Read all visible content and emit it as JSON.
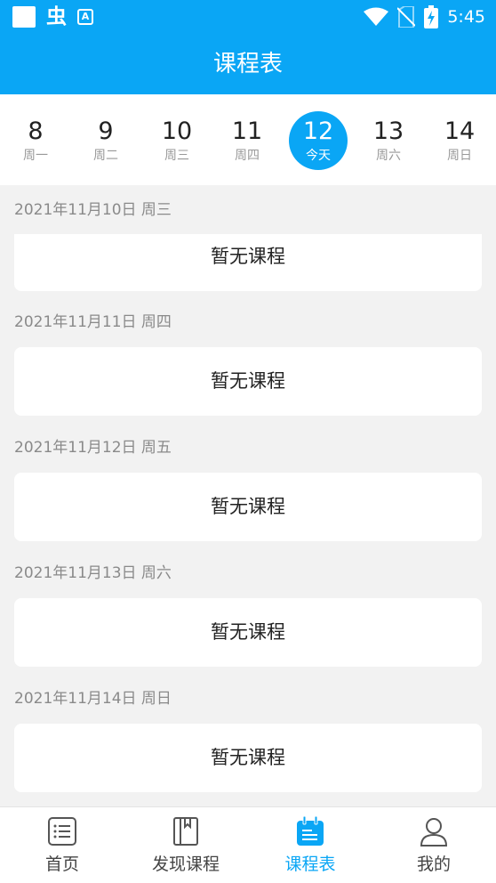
{
  "status_bar": {
    "time": "5:45",
    "app_icon_glyph": "虫",
    "a_badge": "A"
  },
  "header": {
    "title": "课程表"
  },
  "week": {
    "days": [
      {
        "num": "8",
        "label": "周一"
      },
      {
        "num": "9",
        "label": "周二"
      },
      {
        "num": "10",
        "label": "周三"
      },
      {
        "num": "11",
        "label": "周四"
      },
      {
        "num": "12",
        "label": "今天"
      },
      {
        "num": "13",
        "label": "周六"
      },
      {
        "num": "14",
        "label": "周日"
      }
    ],
    "selected_index": 4
  },
  "schedule": [
    {
      "date": "2021年11月10日 周三",
      "message": "暂无课程"
    },
    {
      "date": "2021年11月11日 周四",
      "message": "暂无课程"
    },
    {
      "date": "2021年11月12日 周五",
      "message": "暂无课程"
    },
    {
      "date": "2021年11月13日 周六",
      "message": "暂无课程"
    },
    {
      "date": "2021年11月14日 周日",
      "message": "暂无课程"
    }
  ],
  "tabs": [
    {
      "label": "首页",
      "icon": "home-list-icon"
    },
    {
      "label": "发现课程",
      "icon": "book-icon"
    },
    {
      "label": "课程表",
      "icon": "calendar-icon"
    },
    {
      "label": "我的",
      "icon": "user-icon"
    }
  ],
  "colors": {
    "accent": "#0aa6f5",
    "background": "#f2f2f2"
  }
}
